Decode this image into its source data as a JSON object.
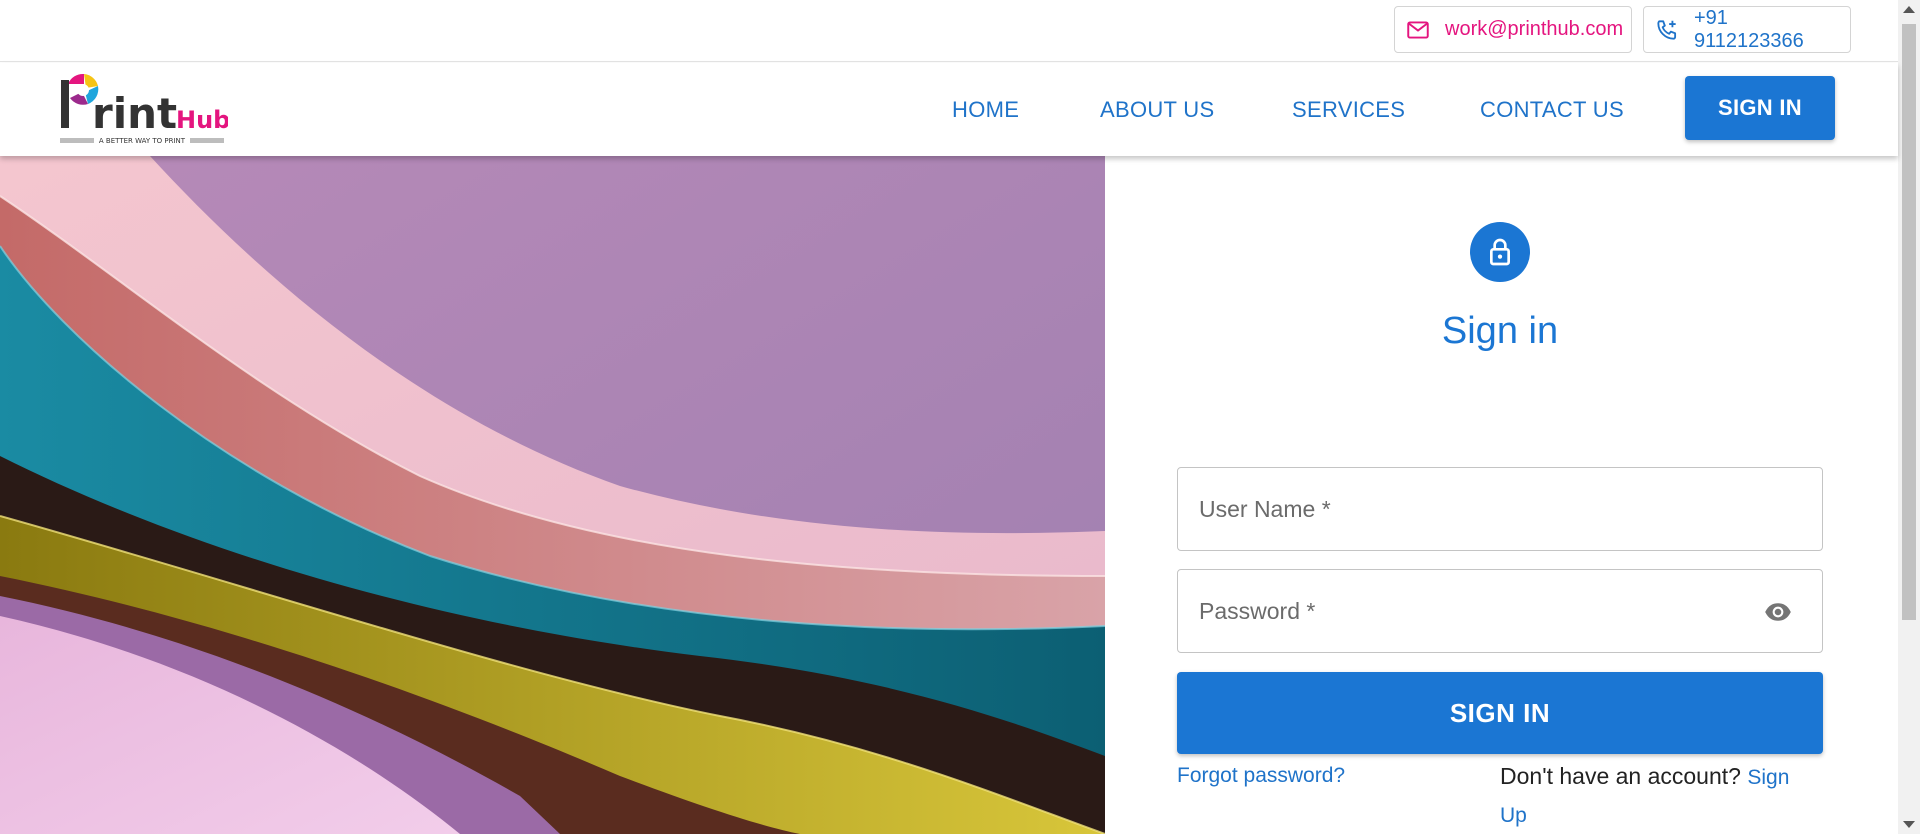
{
  "contact": {
    "email": "work@printhub.com",
    "email_icon": "mail-icon",
    "phone": "+91 9112123366",
    "phone_icon": "phone-icon"
  },
  "brand": {
    "name_main": "Print",
    "name_accent": "Hub",
    "tagline": "A BETTER WAY TO PRINT",
    "accent_color": "#e4157f"
  },
  "nav": {
    "items": [
      {
        "label": "HOME"
      },
      {
        "label": "ABOUT US"
      },
      {
        "label": "SERVICES"
      },
      {
        "label": "CONTACT US"
      }
    ],
    "signin_label": "SIGN IN"
  },
  "form": {
    "icon": "lock-icon",
    "title": "Sign in",
    "username_placeholder": "User Name *",
    "password_placeholder": "Password *",
    "show_password_icon": "eye-icon",
    "submit_label": "SIGN IN",
    "forgot_label": "Forgot password?",
    "signup_prompt": "Don't have an account?",
    "signup_label": "Sign Up"
  },
  "colors": {
    "primary": "#1b76d3",
    "link": "#1f73c9"
  }
}
